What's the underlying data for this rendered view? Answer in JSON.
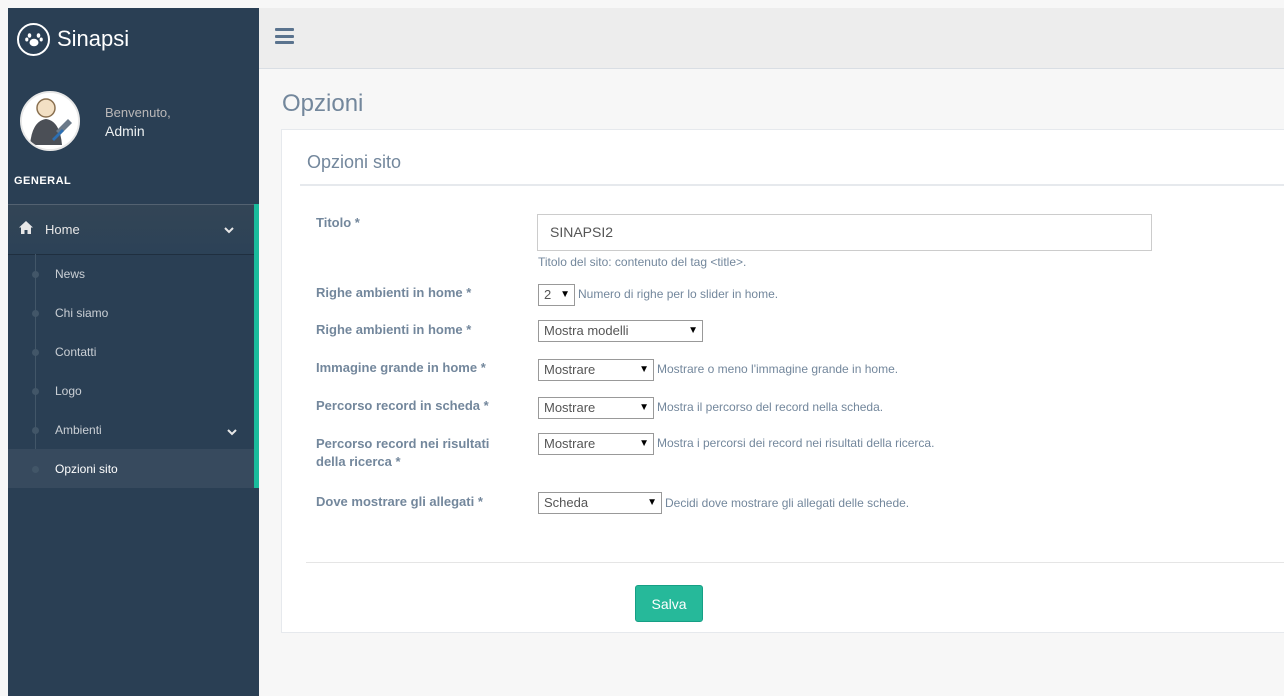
{
  "brand": {
    "name": "Sinapsi",
    "icon": "paw-icon"
  },
  "profile": {
    "welcome": "Benvenuto,",
    "name": "Admin"
  },
  "sidebar": {
    "section": "GENERAL",
    "home_label": "Home",
    "items": [
      {
        "label": "News"
      },
      {
        "label": "Chi siamo"
      },
      {
        "label": "Contatti"
      },
      {
        "label": "Logo"
      },
      {
        "label": "Ambienti"
      },
      {
        "label": "Opzioni sito"
      }
    ]
  },
  "page": {
    "title": "Opzioni",
    "panel_title": "Opzioni sito"
  },
  "form": {
    "titolo": {
      "label": "Titolo *",
      "value": "SINAPSI2",
      "help": "Titolo del sito: contenuto del tag <title>."
    },
    "righe": {
      "label": "Righe ambienti in home *",
      "value": "2",
      "help": "Numero di righe per lo slider in home."
    },
    "righe_modelli": {
      "label": "Righe ambienti in home *",
      "value": "Mostra modelli"
    },
    "immagine": {
      "label": "Immagine grande in home *",
      "value": "Mostrare",
      "help": "Mostrare o meno l'immagine grande in home."
    },
    "percorso_scheda": {
      "label": "Percorso record in scheda *",
      "value": "Mostrare",
      "help": "Mostra il percorso del record nella scheda."
    },
    "percorso_risultati": {
      "label_line1": "Percorso record nei risultati",
      "label_line2": "della ricerca *",
      "value": "Mostrare",
      "help": "Mostra i percorsi dei record nei risultati della ricerca."
    },
    "allegati": {
      "label": "Dove mostrare gli allegati *",
      "value": "Scheda",
      "help": "Decidi dove mostrare gli allegati delle schede."
    },
    "save_label": "Salva"
  },
  "colors": {
    "sidebar": "#2a3f54",
    "accent": "#1abb9c",
    "button": "#26b99a"
  }
}
